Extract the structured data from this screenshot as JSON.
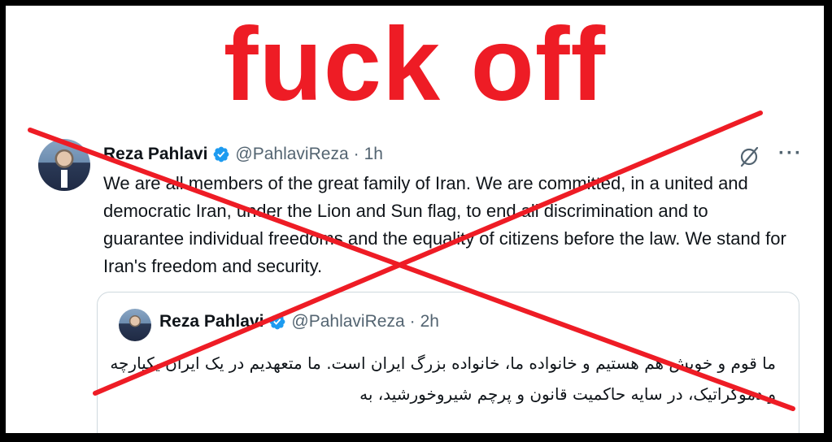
{
  "overlay": {
    "headline": "fuck off",
    "headline_color": "#ee1c25",
    "cross_color": "#ee1c25"
  },
  "tweet": {
    "author_name": "Reza Pahlavi",
    "verified_icon": "verified-badge-icon",
    "handle": "@PahlaviReza",
    "separator": "·",
    "time": "1h",
    "text": "We are all members of the great family of Iran. We are committed, in a united and democratic Iran, under the Lion and Sun flag, to end all discrimination and to guarantee individual freedoms and the equality of citizens before the law. We stand for Iran's freedom and security.",
    "more_label": "···"
  },
  "quoted_tweet": {
    "author_name": "Reza Pahlavi",
    "handle": "@PahlaviReza",
    "separator": "·",
    "time": "2h",
    "text": "ما قوم و خویش هم هستیم و خانواده ما، خانواده بزرگ ایران است. ما متعهدیم در یک ایران یکپارچه و دموکراتیک، در سایه حاکمیت قانون و پرچم شیروخورشید، به"
  },
  "colors": {
    "verified_blue": "#1d9bf0",
    "text_primary": "#0f1419",
    "text_secondary": "#536471"
  }
}
